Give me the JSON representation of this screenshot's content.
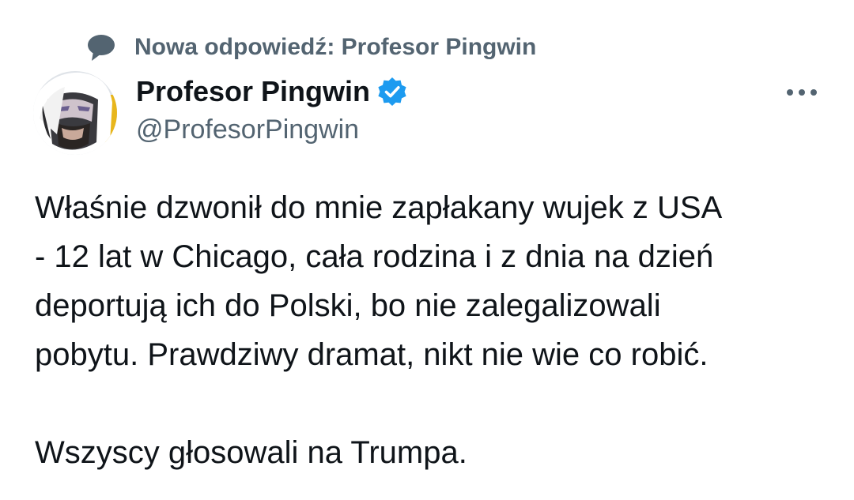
{
  "reply_context": {
    "icon": "speech-bubble-icon",
    "text": "Nowa odpowiedź: Profesor Pingwin"
  },
  "author": {
    "display_name": "Profesor Pingwin",
    "handle": "@ProfesorPingwin",
    "verified_icon": "verified-badge-icon",
    "avatar_icon": "avatar-image"
  },
  "more_icon": "more-options-icon",
  "tweet": {
    "lines": [
      "Właśnie dzwonił do mnie zapłakany wujek z USA",
      "- 12 lat w Chicago, cała rodzina i z dnia na dzień",
      "deportują ich do Polski, bo nie zalegalizowali",
      "pobytu. Prawdziwy dramat, nikt nie wie co robić."
    ],
    "closing_line": "Wszyscy głosowali na Trumpa."
  },
  "colors": {
    "text_primary": "#0f1419",
    "text_secondary": "#536471",
    "verified_blue": "#1d9bf0"
  }
}
